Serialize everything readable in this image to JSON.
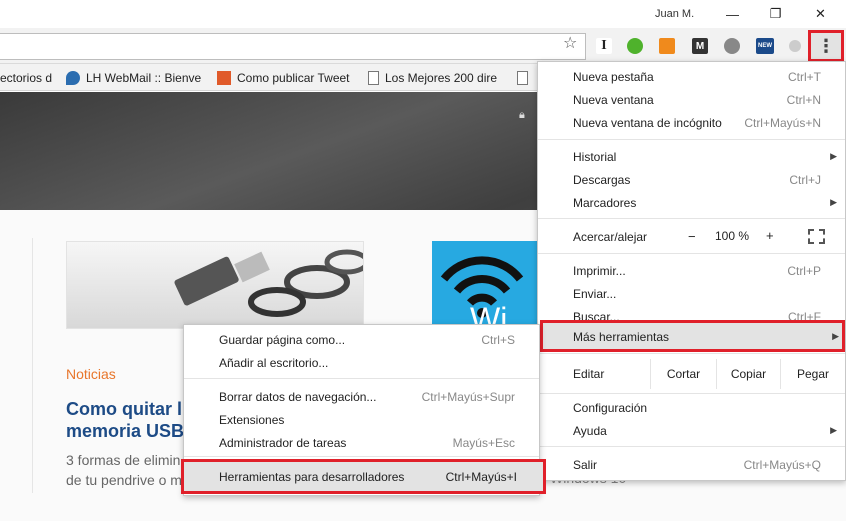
{
  "window": {
    "user_name": "Juan M.",
    "minimize": "—",
    "restore": "❐",
    "close": "✕"
  },
  "toolbar": {
    "star_icon": "☆",
    "menu_icon": "⋮",
    "extensions": [
      {
        "name": "instapaper",
        "glyph": "I",
        "color": "#222222"
      },
      {
        "name": "evernote",
        "glyph": "⬤",
        "color": "#4fb22c"
      },
      {
        "name": "rss",
        "glyph": "◣",
        "color": "#f08a1c"
      },
      {
        "name": "mega",
        "glyph": "M",
        "color": "#333333"
      },
      {
        "name": "gear-ext",
        "glyph": "✲",
        "color": "#777777"
      },
      {
        "name": "new-ext",
        "glyph": "NEW",
        "color": "#1b4a8a"
      },
      {
        "name": "grey-ext",
        "glyph": "●",
        "color": "#bbbbbb"
      }
    ]
  },
  "bookmarks": [
    {
      "label": "ectorios d"
    },
    {
      "label": "LH WebMail :: Bienve"
    },
    {
      "label": "Como publicar Tweet"
    },
    {
      "label": "Los Mejores 200 dire"
    }
  ],
  "page": {
    "category": "Noticias",
    "article_title_1": "Como quitar l",
    "article_title_2": "memoria USB",
    "excerpt_1": "3 formas de elimin",
    "excerpt_2": "de tu pendrive o m",
    "excerpt_right": "Windows 10",
    "thumb2_text": "Wi"
  },
  "main_menu": {
    "new_tab": {
      "label": "Nueva pestaña",
      "shortcut": "Ctrl+T"
    },
    "new_window": {
      "label": "Nueva ventana",
      "shortcut": "Ctrl+N"
    },
    "incognito": {
      "label": "Nueva ventana de incógnito",
      "shortcut": "Ctrl+Mayús+N"
    },
    "history": {
      "label": "Historial"
    },
    "downloads": {
      "label": "Descargas",
      "shortcut": "Ctrl+J"
    },
    "bookmarks": {
      "label": "Marcadores"
    },
    "zoom": {
      "label": "Acercar/alejar",
      "minus": "−",
      "value": "100 %",
      "plus": "+"
    },
    "print": {
      "label": "Imprimir...",
      "shortcut": "Ctrl+P"
    },
    "send": {
      "label": "Enviar..."
    },
    "find": {
      "label": "Buscar...",
      "shortcut": "Ctrl+F"
    },
    "more_tools": {
      "label": "Más herramientas"
    },
    "edit": {
      "label": "Editar",
      "cut": "Cortar",
      "copy": "Copiar",
      "paste": "Pegar"
    },
    "settings": {
      "label": "Configuración"
    },
    "help": {
      "label": "Ayuda"
    },
    "exit": {
      "label": "Salir",
      "shortcut": "Ctrl+Mayús+Q"
    }
  },
  "sub_menu": {
    "save_page": {
      "label": "Guardar página como...",
      "shortcut": "Ctrl+S"
    },
    "add_desktop": {
      "label": "Añadir al escritorio..."
    },
    "clear_data": {
      "label": "Borrar datos de navegación...",
      "shortcut": "Ctrl+Mayús+Supr"
    },
    "extensions": {
      "label": "Extensiones"
    },
    "task_manager": {
      "label": "Administrador de tareas",
      "shortcut": "Mayús+Esc"
    },
    "dev_tools": {
      "label": "Herramientas para desarrolladores",
      "shortcut": "Ctrl+Mayús+I"
    }
  },
  "colors": {
    "highlight_border": "#e0202a",
    "article_title": "#1d4b86",
    "category": "#e8762b"
  }
}
